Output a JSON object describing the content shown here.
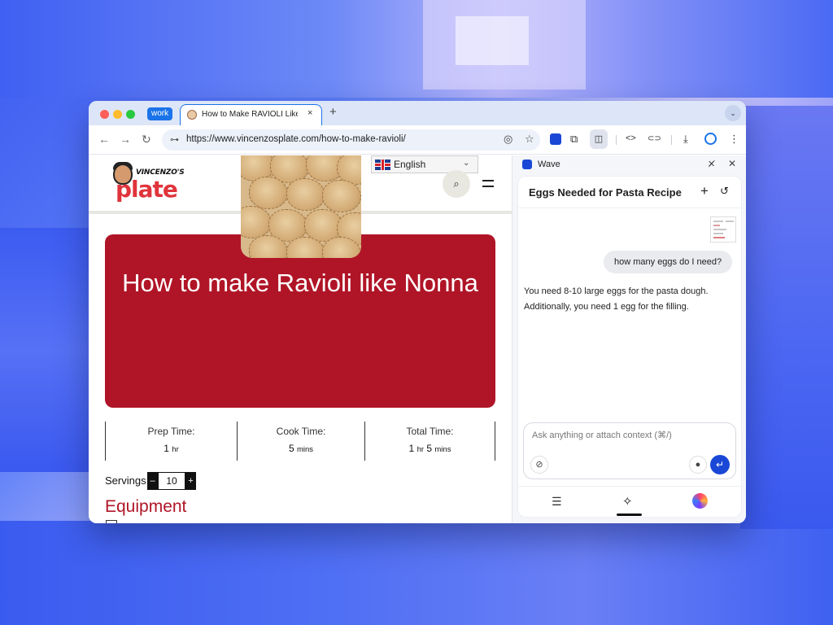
{
  "browser": {
    "tab_group_label": "work",
    "tab_title": "How to Make RAVIOLI Like Nonna",
    "tab_close_icon": "×",
    "new_tab_icon": "+",
    "tab_menu_icon": "⌄",
    "url": "https://www.vincenzosplate.com/how-to-make-ravioli/",
    "icons": {
      "back": "←",
      "forward": "→",
      "reload": "↻",
      "site_info": "⊶",
      "eye_off": "◎",
      "star": "☆",
      "extensions": "⧉",
      "side_panel": "◫",
      "code": "<>",
      "link": "⊂⊃",
      "download": "⤓",
      "menu": "⋮"
    }
  },
  "site": {
    "logo_small": "VINCENZO'S",
    "logo_big": "plate",
    "language": "English",
    "lang_chevron": "⌄",
    "search_icon": "⌕",
    "hero_title": "How to make Ravioli like Nonna",
    "times": [
      {
        "label": "Prep Time:",
        "value": "1",
        "unit": "hr"
      },
      {
        "label": "Cook Time:",
        "value": "5",
        "unit": "mins"
      },
      {
        "label": "Total Time:",
        "value": "1",
        "unit": "hr",
        "value2": "5",
        "unit2": "mins"
      }
    ],
    "servings_label": "Servings:",
    "servings_value": "10",
    "minus": "–",
    "plus": "+",
    "section_heading": "Equipment"
  },
  "panel": {
    "title": "Wave",
    "pin_icon": "✕̸",
    "close_icon": "✕",
    "chat_title": "Eggs Needed for Pasta Recipe",
    "new_chat_icon": "+",
    "history_icon": "↺",
    "user_message": "how many eggs do I need?",
    "assistant_lines": [
      "You need 8-10 large eggs for the pasta dough.",
      "Additionally, you need 1 egg for the filling."
    ],
    "composer_placeholder": "Ask anything or attach context (⌘/)",
    "attach_icon": "⊘",
    "mic_icon": "●",
    "send_icon": "↵",
    "nav_list_icon": "☰",
    "nav_spark_icon": "✧"
  }
}
